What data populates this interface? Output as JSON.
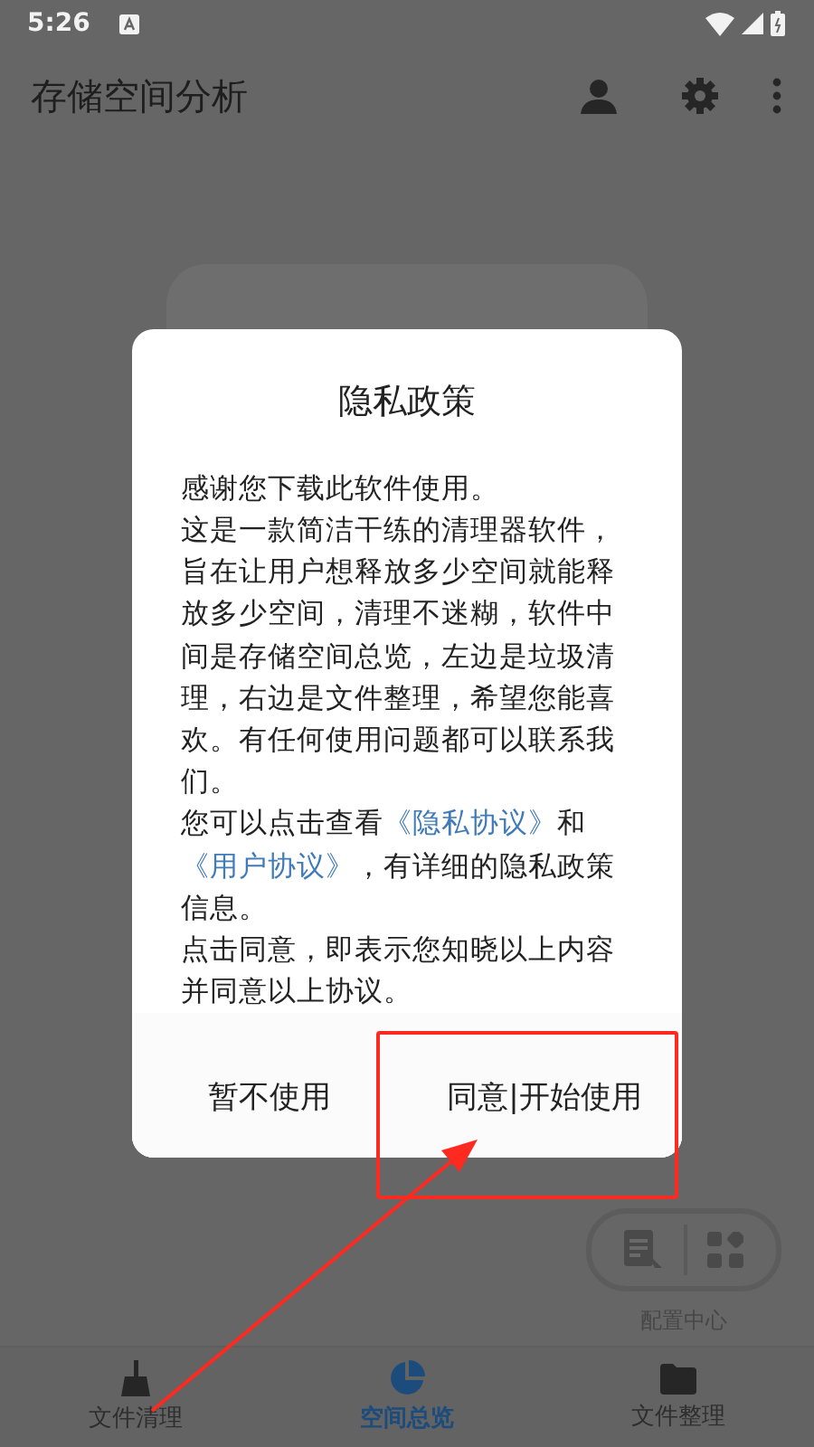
{
  "status_bar": {
    "time": "5:26"
  },
  "app_bar": {
    "title": "存储空间分析",
    "actions": [
      {
        "kind": "person"
      },
      {
        "kind": "settings"
      },
      {
        "kind": "more"
      }
    ]
  },
  "dialog": {
    "title": "隐私政策",
    "paragraphs": [
      [
        {
          "text": "感谢您下载此软件使用。"
        }
      ],
      [
        {
          "text": "这是一款简洁干练的清理器软件，旨在让用户想释放多少空间就能释放多少空间，清理不迷糊，软件中间是存储空间总览，左边是垃圾清理，右边是文件整理，希望您能喜欢。有任何使用问题都可以联系我们。"
        }
      ],
      [
        {
          "text": "您可以点击查看"
        },
        {
          "text": "《隐私协议》",
          "link": true
        },
        {
          "text": "和"
        },
        {
          "text": "《用户协议》",
          "link": true
        },
        {
          "text": "，有详细的隐私政策信息。"
        }
      ],
      [
        {
          "text": "点击同意，即表示您知晓以上内容并同意以上协议。"
        }
      ]
    ],
    "buttons": [
      "暂不使用",
      "同意|开始使用"
    ]
  },
  "config_center": {
    "label": "配置中心"
  },
  "bottom_nav": [
    {
      "label": "文件清理",
      "kind": "broom",
      "selected": false
    },
    {
      "label": "空间总览",
      "kind": "pie",
      "selected": true
    },
    {
      "label": "文件整理",
      "kind": "folder",
      "selected": false
    }
  ]
}
